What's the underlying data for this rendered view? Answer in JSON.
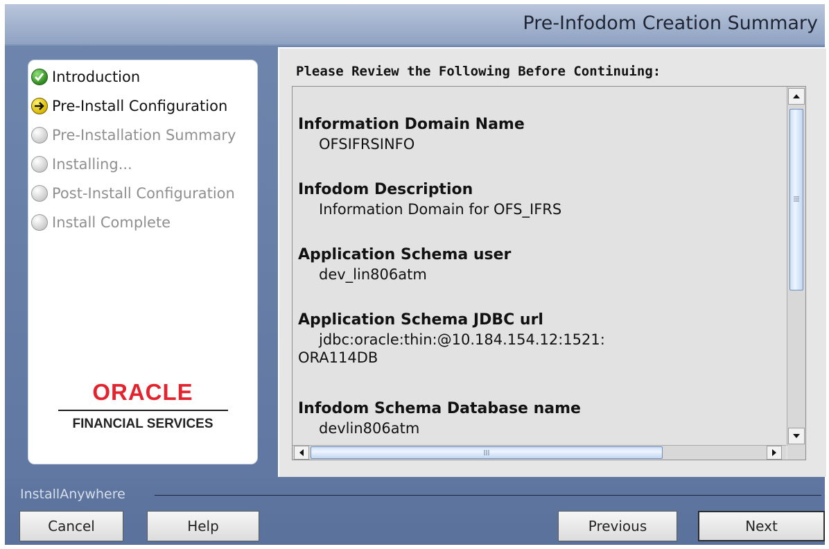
{
  "window": {
    "title": "Pre-Infodom Creation Summary"
  },
  "steps": [
    {
      "label": "Introduction",
      "state": "done"
    },
    {
      "label": "Pre-Install Configuration",
      "state": "current"
    },
    {
      "label": "Pre-Installation Summary",
      "state": "pending"
    },
    {
      "label": "Installing...",
      "state": "pending"
    },
    {
      "label": "Post-Install Configuration",
      "state": "pending"
    },
    {
      "label": "Install Complete",
      "state": "pending"
    }
  ],
  "logo": {
    "wordmark": "ORACLE",
    "subtitle": "FINANCIAL SERVICES"
  },
  "content": {
    "heading": "Please Review the Following Before Continuing:",
    "items": [
      {
        "title": "Information Domain Name",
        "value": "OFSIFRSINFO"
      },
      {
        "title": "Infodom Description",
        "value": "Information Domain for OFS_IFRS"
      },
      {
        "title": "Application Schema user",
        "value": "dev_lin806atm"
      },
      {
        "title": "Application Schema JDBC url",
        "value": "jdbc:oracle:thin:@10.184.154.12:1521:",
        "value_cont": "ORA114DB"
      },
      {
        "title": "Infodom Schema Database name",
        "value": "devlin806atm"
      }
    ]
  },
  "footer": {
    "brand": "InstallAnywhere",
    "cancel": "Cancel",
    "help": "Help",
    "previous": "Previous",
    "next": "Next"
  },
  "colors": {
    "accent": "#6f86ad",
    "logo_red": "#e3232d"
  }
}
